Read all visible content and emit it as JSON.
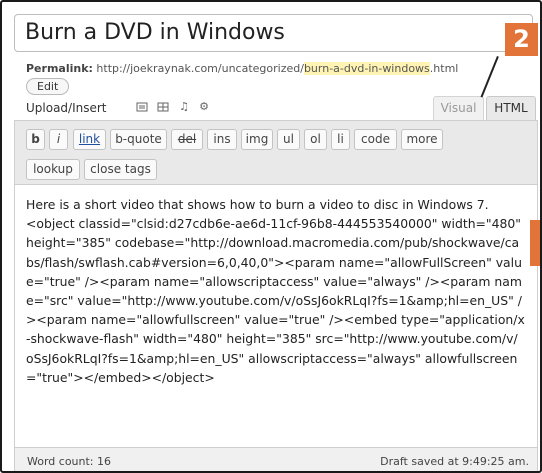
{
  "post": {
    "title": "Burn a DVD in Windows",
    "permalink_label": "Permalink:",
    "permalink_base": "http://joekraynak.com/uncategorized/",
    "permalink_slug": "burn-a-dvd-in-windows",
    "permalink_ext": ".html",
    "edit_label": "Edit"
  },
  "upload": {
    "label": "Upload/Insert",
    "icons": [
      "image-icon",
      "video-icon",
      "audio-icon",
      "media-icon"
    ]
  },
  "tabs": [
    {
      "label": "Visual",
      "active": false
    },
    {
      "label": "HTML",
      "active": true
    }
  ],
  "quicktags": {
    "row1": [
      "b",
      "i",
      "link",
      "b-quote",
      "del",
      "ins",
      "img",
      "ul",
      "ol",
      "li",
      "code",
      "more"
    ],
    "row2": [
      "lookup",
      "close tags"
    ]
  },
  "editor": {
    "content": "Here is a short video that shows how to burn a video to disc in Windows 7.\n<object classid=\"clsid:d27cdb6e-ae6d-11cf-96b8-444553540000\" width=\"480\" height=\"385\" codebase=\"http://download.macromedia.com/pub/shockwave/cabs/flash/swflash.cab#version=6,0,40,0\"><param name=\"allowFullScreen\" value=\"true\" /><param name=\"allowscriptaccess\" value=\"always\" /><param name=\"src\" value=\"http://www.youtube.com/v/oSsJ6okRLqI?fs=1&amp;hl=en_US\" /><param name=\"allowfullscreen\" value=\"true\" /><embed type=\"application/x-shockwave-flash\" width=\"480\" height=\"385\" src=\"http://www.youtube.com/v/oSsJ6okRLqI?fs=1&amp;hl=en_US\" allowscriptaccess=\"always\" allowfullscreen=\"true\"></embed></object>"
  },
  "status": {
    "word_count": "Word count: 16",
    "draft_saved": "Draft saved at 9:49:25 am."
  },
  "callout": {
    "number": "2",
    "color": "#e2743a"
  }
}
